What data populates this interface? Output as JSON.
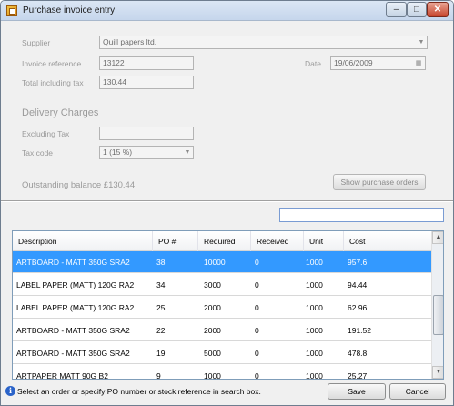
{
  "window": {
    "title": "Purchase invoice entry",
    "min_glyph": "–",
    "max_glyph": "□",
    "close_glyph": "✕"
  },
  "form": {
    "supplier_label": "Supplier",
    "supplier_value": "Quill papers ltd.",
    "invoice_ref_label": "Invoice reference",
    "invoice_ref_value": "13122",
    "total_label": "Total including tax",
    "total_value": "130.44",
    "date_label": "Date",
    "date_value": "19/06/2009"
  },
  "delivery": {
    "title": "Delivery Charges",
    "excluding_tax_label": "Excluding Tax",
    "excluding_tax_value": "",
    "tax_code_label": "Tax code",
    "tax_code_value": "1 (15 %)"
  },
  "balance": {
    "text": "Outstanding balance £130.44",
    "show_orders_label": "Show purchase orders"
  },
  "search": {
    "value": ""
  },
  "grid": {
    "columns": [
      "Description",
      "PO #",
      "Required",
      "Received",
      "Unit",
      "Cost"
    ],
    "rows": [
      {
        "description": "ARTBOARD - MATT 350G SRA2",
        "po": "38",
        "required": "10000",
        "received": "0",
        "unit": "1000",
        "cost": "957.6",
        "selected": true
      },
      {
        "description": "LABEL PAPER (MATT) 120G RA2",
        "po": "34",
        "required": "3000",
        "received": "0",
        "unit": "1000",
        "cost": "94.44",
        "selected": false
      },
      {
        "description": "LABEL PAPER (MATT) 120G RA2",
        "po": "25",
        "required": "2000",
        "received": "0",
        "unit": "1000",
        "cost": "62.96",
        "selected": false
      },
      {
        "description": "ARTBOARD - MATT 350G SRA2",
        "po": "22",
        "required": "2000",
        "received": "0",
        "unit": "1000",
        "cost": "191.52",
        "selected": false
      },
      {
        "description": "ARTBOARD - MATT 350G SRA2",
        "po": "19",
        "required": "5000",
        "received": "0",
        "unit": "1000",
        "cost": "478.8",
        "selected": false
      },
      {
        "description": "ARTPAPER MATT 90G B2",
        "po": "9",
        "required": "1000",
        "received": "0",
        "unit": "1000",
        "cost": "25.27",
        "selected": false
      }
    ]
  },
  "status": {
    "text": "Select an order or specify PO number or stock reference in search box.",
    "save_label": "Save",
    "cancel_label": "Cancel"
  }
}
